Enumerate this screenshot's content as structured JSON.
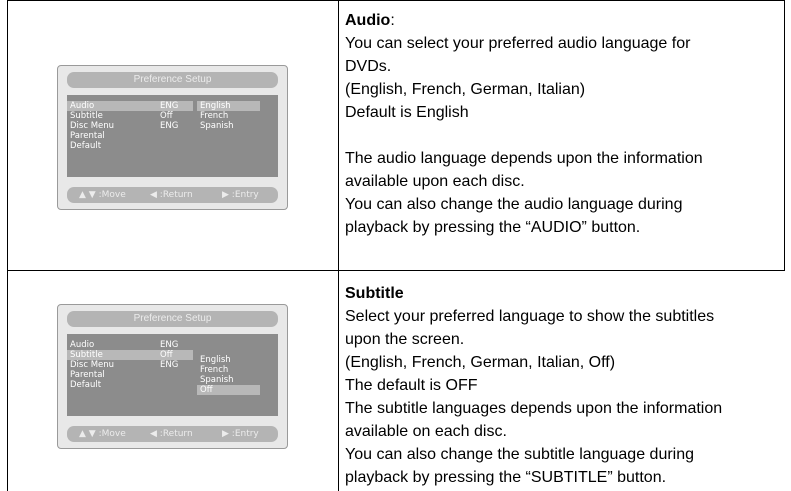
{
  "rows": [
    {
      "osd": {
        "header": "Preference Setup",
        "items": [
          "Audio",
          "Subtitle",
          "Disc Menu",
          "Parental",
          "Default"
        ],
        "values": [
          "ENG",
          "Off",
          "ENG"
        ],
        "options": [
          "English",
          "French",
          "Spanish"
        ],
        "footer": {
          "move": "▲ ▼ :Move",
          "return": "◀ :Return",
          "entry": "▶ :Entry"
        }
      },
      "title": "Audio",
      "title_suffix": ":",
      "lines": [
        "You can select your preferred audio language for",
        "DVDs.",
        "(English, French, German, Italian)",
        "Default is English",
        "",
        "The audio language depends upon the information",
        "available upon each disc.",
        "You can also change the audio language during",
        "playback by pressing the “AUDIO” button."
      ]
    },
    {
      "osd": {
        "header": "Preference Setup",
        "items": [
          "Audio",
          "Subtitle",
          "Disc Menu",
          "Parental",
          "Default"
        ],
        "values": [
          "ENG",
          "Off",
          "ENG"
        ],
        "options": [
          "English",
          "French",
          "Spanish",
          "Off"
        ],
        "footer": {
          "move": "▲ ▼ :Move",
          "return": "◀ :Return",
          "entry": "▶ :Entry"
        }
      },
      "title": "Subtitle",
      "title_suffix": "",
      "lines": [
        "Select your preferred language to show the subtitles",
        "upon the screen.",
        "(English, French, German, Italian, Off)",
        "The default is OFF",
        "The subtitle languages depends upon the information",
        "available on each disc.",
        "You can also change the subtitle language during",
        "playback by pressing the “SUBTITLE” button."
      ]
    }
  ]
}
